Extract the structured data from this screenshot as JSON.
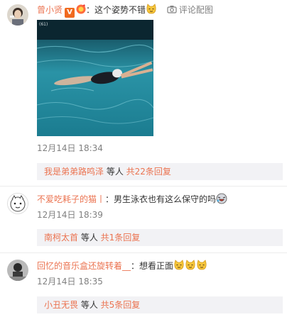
{
  "comments": [
    {
      "username": "曾小贤",
      "badge_v": "V",
      "separator": "：",
      "text": "这个姿势不错",
      "photo_link": "评论配图",
      "time": "12月14日 18:34",
      "reply": {
        "name": "我是弟弟路鸣泽",
        "middle": " 等人 ",
        "count": "共22条回复"
      }
    },
    {
      "username": "不爱吃耗子的猫丨",
      "separator": "：",
      "text": "男生泳衣也有这么保守的吗",
      "time": "12月14日 18:39",
      "reply": {
        "name": "南柯太首",
        "middle": " 等人 ",
        "count": "共1条回复"
      }
    },
    {
      "username": "回忆的音乐盒还旋转着__",
      "separator": "：",
      "text": "想看正面",
      "time": "12月14日 18:35",
      "reply": {
        "name": "小丑无畏",
        "middle": " 等人 ",
        "count": "共5条回复"
      }
    }
  ],
  "colors": {
    "accent": "#eb7350",
    "reply_bg": "#f2f2f5",
    "meta": "#808080"
  },
  "icons": [
    "cat-emoji-icon",
    "medal-icon",
    "camera-icon",
    "laughing-face-icon"
  ]
}
